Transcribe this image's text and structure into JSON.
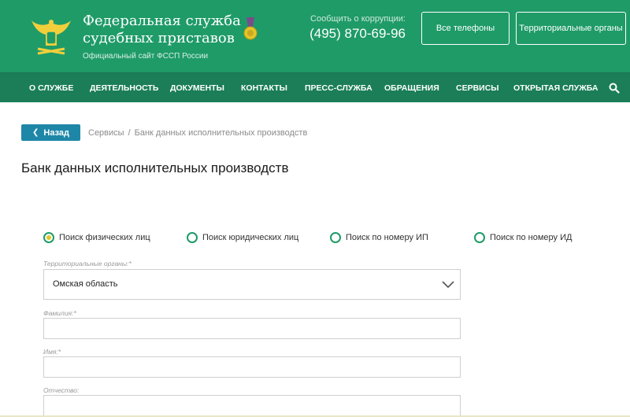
{
  "header": {
    "title": "Федеральная служба судебных приставов",
    "subtitle": "Официальный сайт ФССП России",
    "corruption_label": "Сообщить о коррупции:",
    "corruption_phone": "(495) 870-69-96",
    "btn_phones": "Все телефоны",
    "btn_regions": "Территориальные органы",
    "emblem_icon": "eagle-emblem-icon",
    "medal_icon": "medal-icon"
  },
  "nav": {
    "items": [
      "О СЛУЖБЕ",
      "ДЕЯТЕЛЬНОСТЬ",
      "ДОКУМЕНТЫ",
      "КОНТАКТЫ",
      "ПРЕСС-СЛУЖБА",
      "ОБРАЩЕНИЯ",
      "СЕРВИСЫ",
      "ОТКРЫТАЯ СЛУЖБА"
    ],
    "search_icon": "search-icon"
  },
  "breadcrumb": {
    "back_label": "Назад",
    "crumbs": [
      "Сервисы",
      "Банк данных исполнительных производств"
    ],
    "separator": "/"
  },
  "page": {
    "title": "Банк данных исполнительных производств"
  },
  "search_type": {
    "options": [
      "Поиск физических лиц",
      "Поиск юридических лиц",
      "Поиск по номеру ИП",
      "Поиск по номеру ИД"
    ],
    "selected": "Поиск физических лиц"
  },
  "form": {
    "region_label": "Территориальные органы:*",
    "region_value": "Омская область",
    "last_name_label": "Фамилия:*",
    "last_name_value": "",
    "first_name_label": "Имя:*",
    "first_name_value": "",
    "middle_name_label": "Отчество:",
    "middle_name_value": ""
  },
  "colors": {
    "header_green": "#1f9b68",
    "nav_green": "#1b7e58",
    "back_button": "#1e87a8",
    "radio_selected": "#e3c62a"
  }
}
